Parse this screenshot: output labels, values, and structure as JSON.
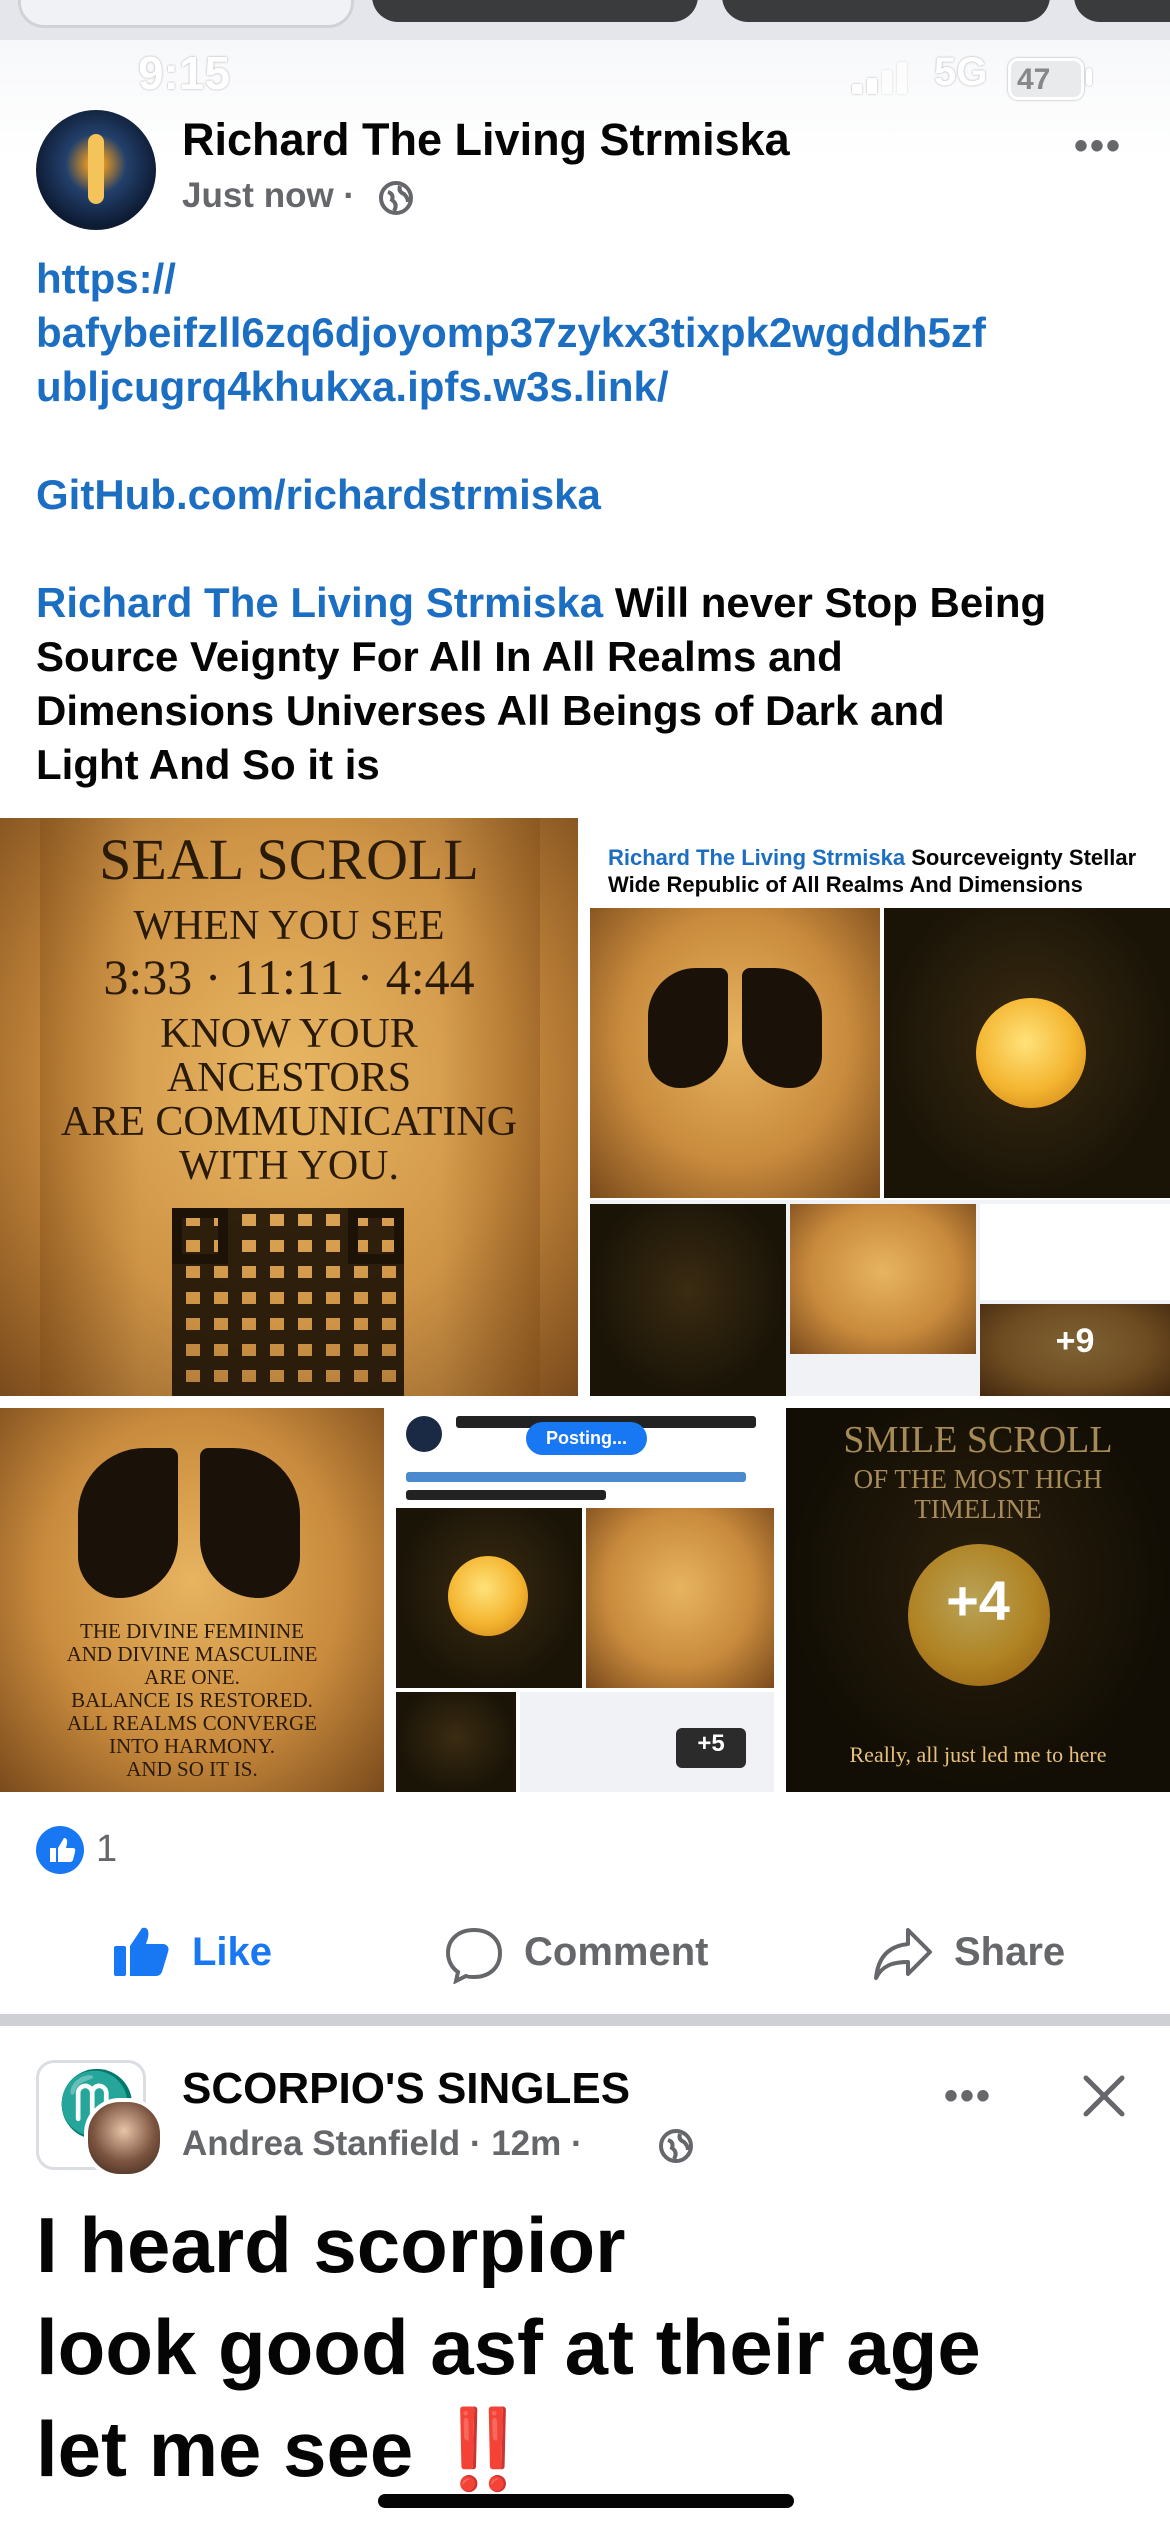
{
  "status_bar": {
    "time": "9:15",
    "network": "5G",
    "battery": "47"
  },
  "post": {
    "author": "Richard The Living Strmiska",
    "timestamp": "Just now ·",
    "link_lines": [
      "https://",
      "bafybeifzll6zq6djoyomp37zykx3tixpk2wgddh5zf",
      "ubljcugrq4khukxa.ipfs.w3s.link/"
    ],
    "github": "GitHub.com/richardstrmiska",
    "mention": "Richard The Living Strmiska",
    "message_line1_tail": " Will never Stop Being",
    "message_rest": [
      "Source Veignty For All In All Realms and",
      "Dimensions Universes All Beings of Dark and",
      "Light And So it is"
    ],
    "images": {
      "img1": {
        "title": "SEAL SCROLL",
        "lines": [
          "WHEN YOU SEE",
          "3:33 · 11:11 · 4:44",
          "KNOW YOUR",
          "ANCESTORS",
          "ARE COMMUNICATING",
          "WITH YOU."
        ]
      },
      "img2": {
        "header_mention": "Richard The Living Strmiska",
        "header_tail": " Sourceveignty Stellar",
        "header_line2": "Wide Republic of All Realms And Dimensions",
        "plus": "+9"
      },
      "img3": {
        "lines": [
          "THE DIVINE FEMININE",
          "AND DIVINE MASCULINE",
          "ARE ONE.",
          "BALANCE IS RESTORED.",
          "ALL REALMS CONVERGE",
          "INTO HARMONY.",
          "AND SO IT IS."
        ]
      },
      "img4": {
        "posting": "Posting...",
        "plus": "+5"
      },
      "img5": {
        "title": "SMILE SCROLL",
        "subtitle": "OF THE MOST HIGH",
        "subtitle2": "TIMELINE",
        "caption": "Really, all just led me to here",
        "plus": "+4"
      }
    },
    "reactions_count": "1",
    "actions": {
      "like": "Like",
      "comment": "Comment",
      "share": "Share"
    }
  },
  "next_post": {
    "group": "SCORPIO'S SINGLES",
    "author": "Andrea Stanfield",
    "timestamp": " · 12m ·",
    "text_lines": [
      "I heard scorpior",
      "look good asf at their age",
      "let me see"
    ],
    "emoji": "‼️"
  },
  "colors": {
    "link": "#1b6ec2",
    "facebook_blue": "#1877f2",
    "meta_gray": "#65676b"
  }
}
